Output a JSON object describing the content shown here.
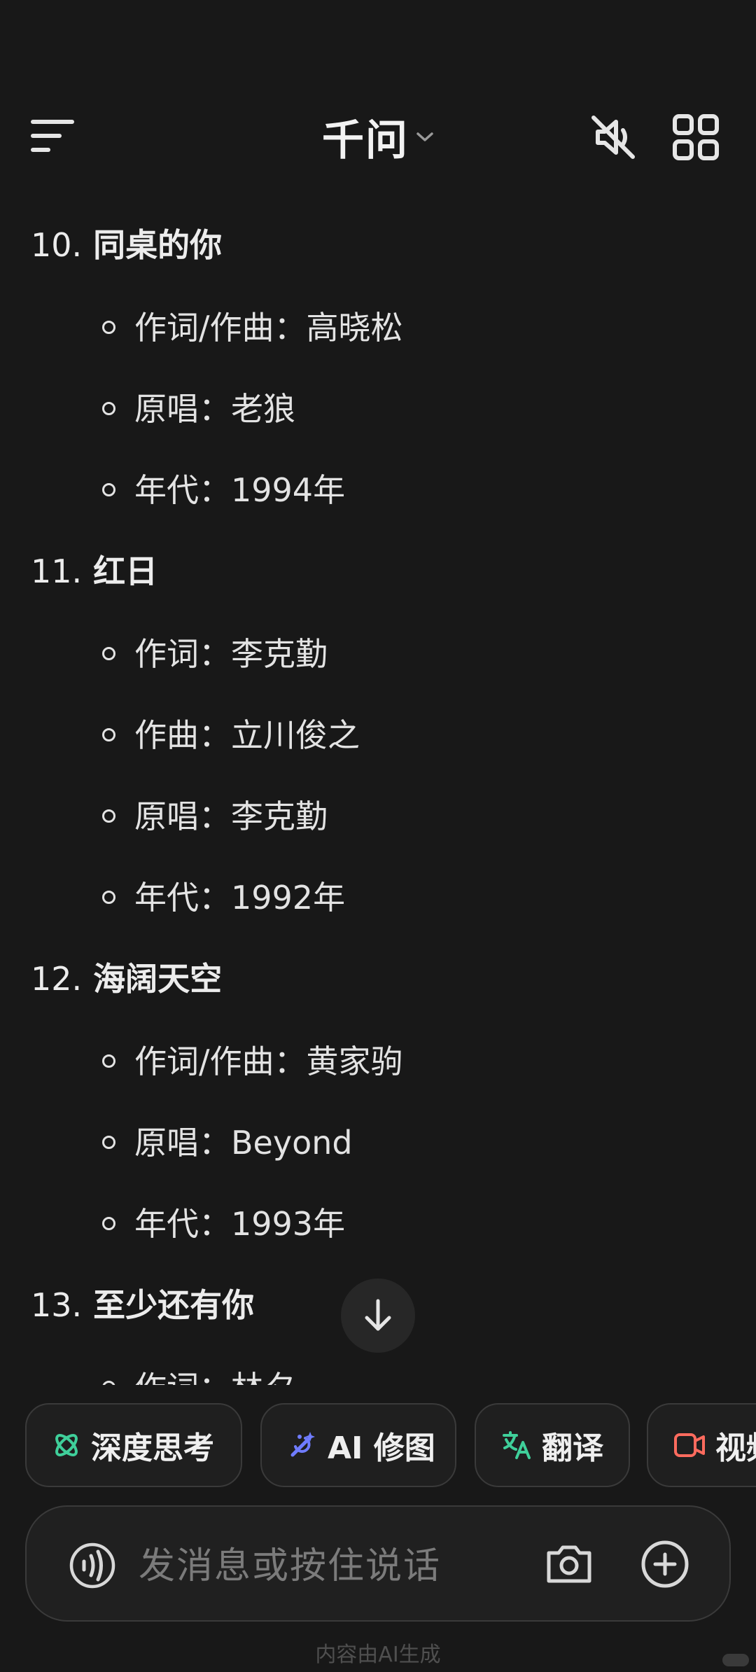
{
  "header": {
    "title": "千问"
  },
  "songs": [
    {
      "number": "10.",
      "title": "同桌的你",
      "details": [
        "作词/作曲：高晓松",
        "原唱：老狼",
        "年代：1994年"
      ]
    },
    {
      "number": "11.",
      "title": "红日",
      "details": [
        "作词：李克勤",
        "作曲：立川俊之",
        "原唱：李克勤",
        "年代：1992年"
      ]
    },
    {
      "number": "12.",
      "title": "海阔天空",
      "details": [
        "作词/作曲：黄家驹",
        "原唱：Beyond",
        "年代：1993年"
      ]
    },
    {
      "number": "13.",
      "title": "至少还有你",
      "details": [
        "作词：林夕"
      ]
    }
  ],
  "chips": [
    {
      "label": "深度思考",
      "icon": "atom-icon",
      "color": "#3fcf9a"
    },
    {
      "label": "AI 修图",
      "icon": "magic-wand-icon",
      "color": "#6f7cff"
    },
    {
      "label": "翻译",
      "icon": "translate-icon",
      "color": "#3fcf9a"
    },
    {
      "label": "视频",
      "icon": "video-call-icon",
      "color": "#ff6b5e"
    }
  ],
  "input": {
    "placeholder": "发消息或按住说话"
  },
  "footer": {
    "note": "内容由AI生成"
  }
}
